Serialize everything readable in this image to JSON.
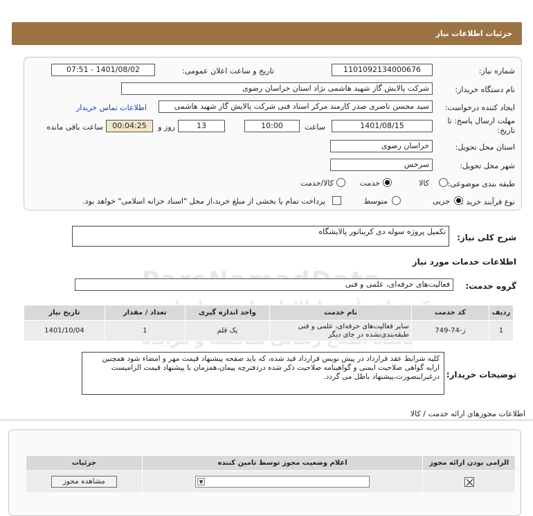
{
  "header": {
    "title": "جزئیات اطلاعات نیاز"
  },
  "form": {
    "need_number_label": "شماره نیاز:",
    "need_number": "1101092134000676",
    "announce_label": "تاریخ و ساعت اعلان عمومی:",
    "announce_value": "1401/08/02 - 07:51",
    "buyer_label": "نام دستگاه خریدار:",
    "buyer_value": "شرکت پالایش گاز شهید هاشمی نژاد   استان خراسان رضوی",
    "creator_label": "ایجاد کننده درخواست:",
    "creator_value": "سید محسن  ناصری صدر کارمند مرکز اسناد فنی شرکت پالایش گاز شهید هاشمی",
    "contact_link": "اطلاعات تماس خریدار",
    "deadline_label_1": "مهلت ارسال پاسخ: تا",
    "deadline_label_2": "تاریخ:",
    "deadline_date": "1401/08/15",
    "time_label": "ساعت",
    "deadline_time": "10:00",
    "days_value": "13",
    "days_label": "روز و",
    "remaining_value": "00:04:25",
    "remaining_label": "ساعت باقی مانده",
    "province_label": "استان محل تحویل:",
    "province_value": "خراسان رضوی",
    "city_label": "شهر محل تحویل:",
    "city_value": "سرخس",
    "category_label": "طبقه بندی موضوعی:",
    "category_options": [
      "کالا",
      "خدمت",
      "کالا/خدمت"
    ],
    "category_selected": "خدمت",
    "process_label": "نوع فرآیند خرید :",
    "process_options": [
      "جزیی",
      "متوسط"
    ],
    "process_selected": "جزیی",
    "payment_note": "پرداخت تمام یا بخشی از مبلغ خرید،از محل \"اسناد خزانه اسلامی\" خواهد بود."
  },
  "summary": {
    "label": "شرح کلی نیاز:",
    "value": "تکمیل پروژه سوله دی کربناتور پالایشگاه"
  },
  "services": {
    "section_title": "اطلاعات خدمات مورد نیاز",
    "group_label": "گروه خدمت:",
    "group_value": "فعالیت‌های حرفه‌ای، علمی و فنی",
    "table": {
      "headers": [
        "ردیف",
        "کد خدمت",
        "نام خدمت",
        "واحد اندازه گیری",
        "تعداد / مقدار",
        "تاریخ نیاز"
      ],
      "rows": [
        [
          "1",
          "ز-74-749",
          "سایر فعالیت‌های حرفه‌ای، علمی و فنی طبقه‌بندی‌نشده در جای دیگر",
          "یک قلم",
          "1",
          "1401/10/04"
        ]
      ]
    }
  },
  "buyer_notes": {
    "label": "توضیحات خریدار:",
    "text": "کلیه شرایط عقد قرارداد در پیش نویس قرارداد قید شده، که باید صفحه پیشنهاد قیمت مهر و امضاء شود همچنین ارایه گواهی صلاحیت ایمنی و گواهینامه صلاحیت ذکر شده دردفترچه پیمان،همزمان با پیشنهاد قیمت الزامیست درغیراینصورت،پیشنهاد باطل می گردد."
  },
  "licenses": {
    "title": "اطلاعات مجوزهای ارائه خدمت / کالا",
    "headers": [
      "الزامی بودن ارائه مجوز",
      "اعلام وضعیت مجوز توسط تامین کننده",
      "جزئیات"
    ],
    "view_button": "مشاهده مجوز"
  },
  "watermark": {
    "line1": "مرکز فراهم آوری اطلاعات پارس نماد داده",
    "line2": "پایگاه اطلاع رسانی مناقصه و مزایده",
    "brand": "ParsNamadData"
  }
}
